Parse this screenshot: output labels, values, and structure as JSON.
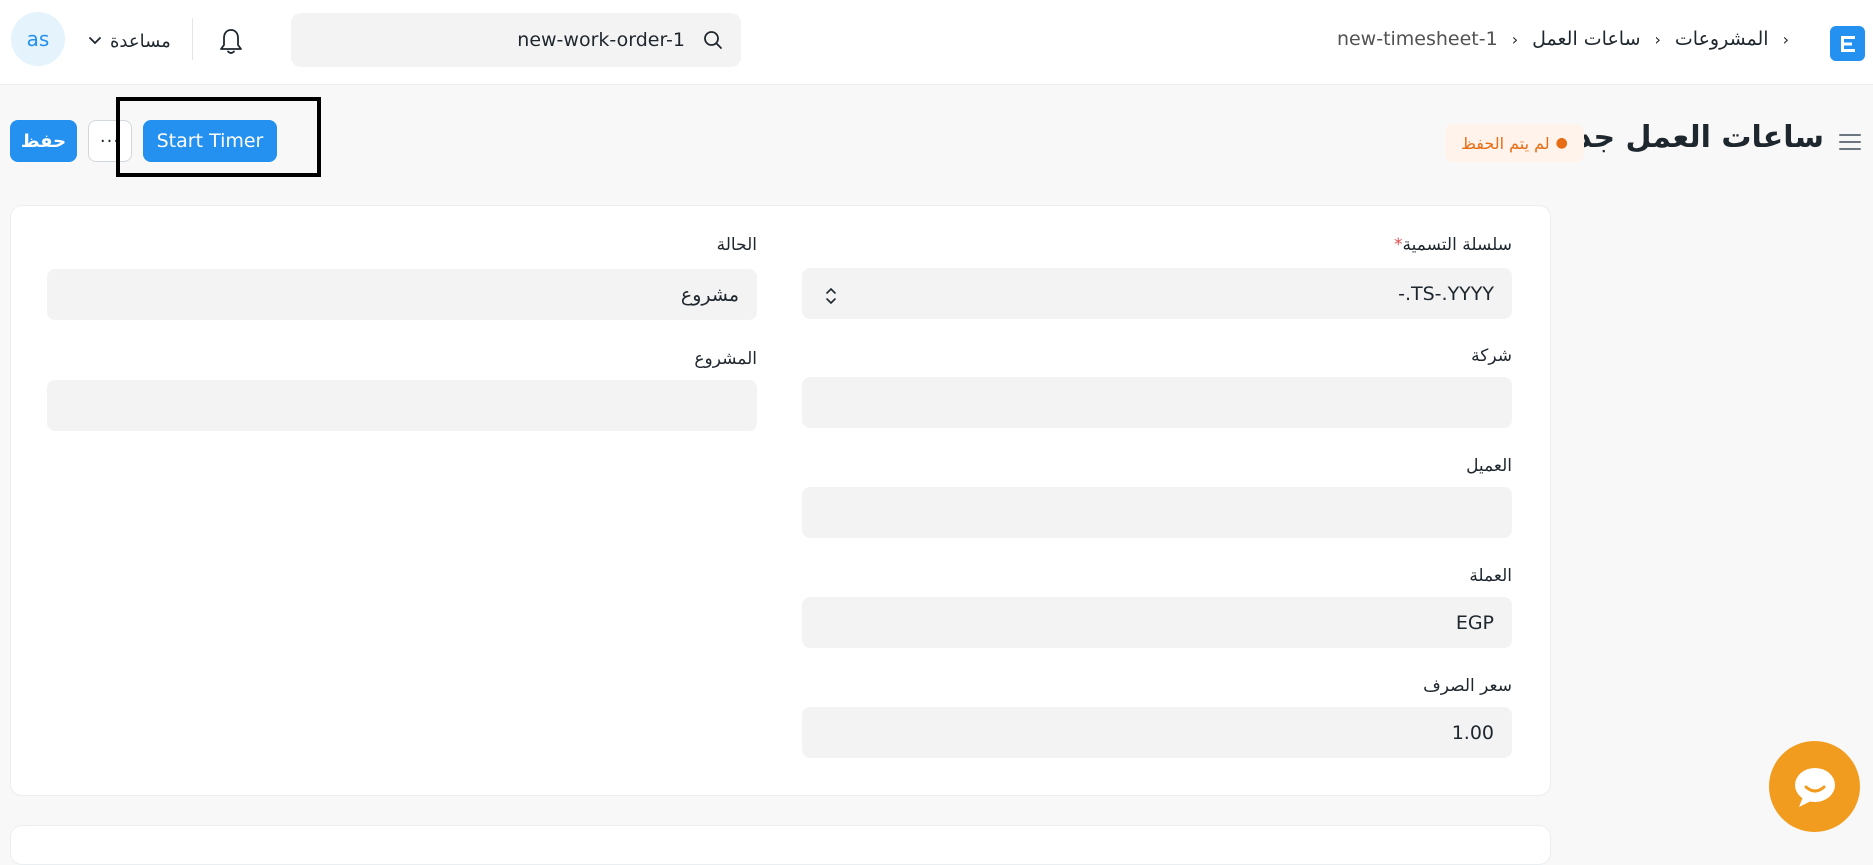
{
  "navbar": {
    "logo_letter": "E",
    "breadcrumbs": [
      "المشروعات",
      "ساعات العمل",
      "new-timesheet-1"
    ],
    "search": {
      "value": "new-work-order-1"
    },
    "help_label": "مساعدة",
    "avatar_initials": "as",
    "accent_color": "#2490ef"
  },
  "page": {
    "title": "ساعات العمل جديد",
    "status_indicator": "لم يتم الحفظ",
    "buttons": {
      "save": "حفظ",
      "more": "···",
      "start_timer": "Start Timer"
    }
  },
  "form": {
    "right_column": [
      {
        "label": "سلسلة التسمية",
        "required_mark": "*",
        "value": "-.TS-.YYYY",
        "type": "select"
      },
      {
        "label": "شركة",
        "value": ""
      },
      {
        "label": "العميل",
        "value": ""
      },
      {
        "label": "العملة",
        "value": "EGP"
      },
      {
        "label": "سعر الصرف",
        "value": "1.00"
      }
    ],
    "left_column": [
      {
        "label": "الحالة",
        "value": "مشروع"
      },
      {
        "label": "المشروع",
        "value": ""
      }
    ]
  },
  "icons": {
    "search": "search-icon",
    "bell": "bell-icon",
    "chevron": "chevron-down-icon",
    "hamburger": "menu-icon",
    "chat": "chat-icon",
    "select": "select-arrows-icon"
  },
  "colors": {
    "primary": "#2490ef",
    "indicator_text": "#e86c13",
    "indicator_bg": "#fff3ec",
    "chat_bubble": "#f29c1f"
  }
}
